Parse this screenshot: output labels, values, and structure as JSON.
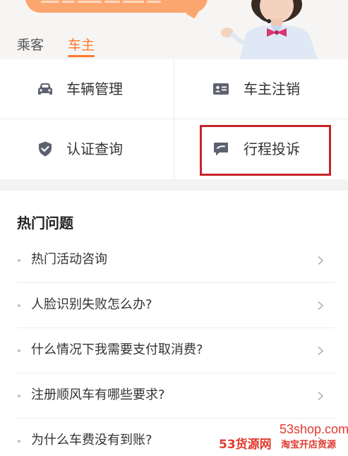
{
  "tabs": {
    "passenger": "乘客",
    "owner": "车主",
    "active": "owner"
  },
  "grid": {
    "items": [
      {
        "label": "车辆管理",
        "icon": "car-icon"
      },
      {
        "label": "车主注销",
        "icon": "id-card-icon"
      },
      {
        "label": "认证查询",
        "icon": "shield-check-icon"
      },
      {
        "label": "行程投诉",
        "icon": "chat-bubble-icon"
      }
    ]
  },
  "faq": {
    "title": "热门问题",
    "items": [
      "热门活动咨询",
      "人脸识别失败怎么办?",
      "什么情况下我需要支付取消费?",
      "注册顺风车有哪些要求?",
      "为什么车费没有到账?"
    ]
  },
  "watermark": {
    "url": "53shop.com",
    "logo": "53货源网",
    "sub": "淘宝开店货源"
  },
  "colors": {
    "accent": "#ff7a2d",
    "highlight": "#c8232c",
    "icon": "#5d6170",
    "bubble": "#fca66f"
  }
}
